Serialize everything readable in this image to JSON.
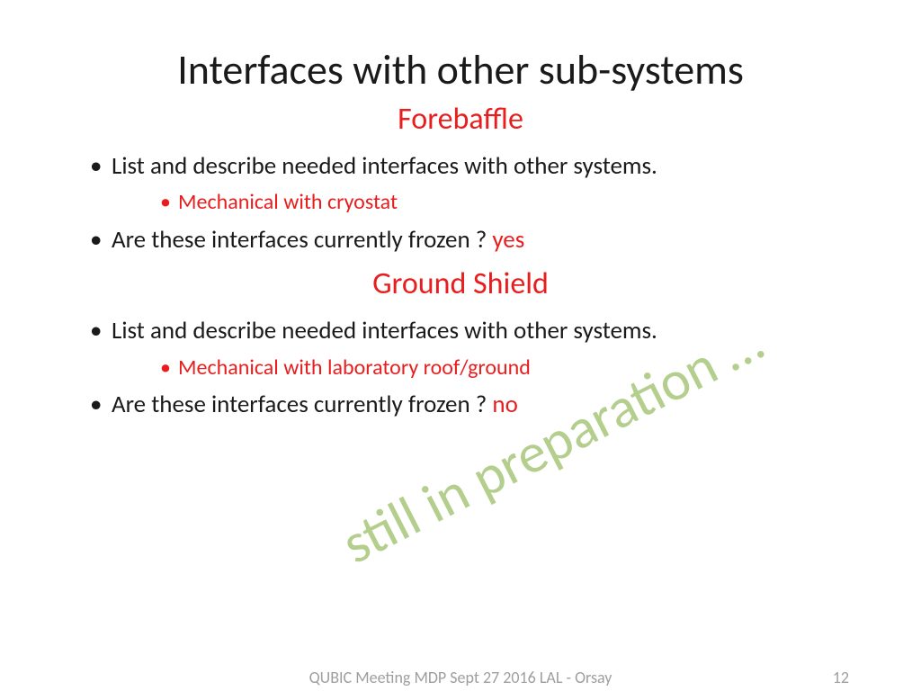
{
  "title": "Interfaces with other sub-systems",
  "sections": [
    {
      "heading": "Forebaffle",
      "bullets": [
        {
          "text": "List and describe needed interfaces with other systems.",
          "sub": "Mechanical with cryostat"
        },
        {
          "text": "Are these interfaces currently frozen ? ",
          "answer": "yes"
        }
      ]
    },
    {
      "heading": "Ground Shield",
      "bullets": [
        {
          "text": "List and describe needed interfaces with other systems.",
          "sub": "Mechanical with laboratory roof/ground"
        },
        {
          "text": "Are these interfaces currently frozen ? ",
          "answer": "no"
        }
      ]
    }
  ],
  "watermark": "still in preparation …",
  "footer": {
    "text": "QUBIC Meeting MDP Sept 27 2016 LAL - Orsay",
    "page": "12"
  }
}
